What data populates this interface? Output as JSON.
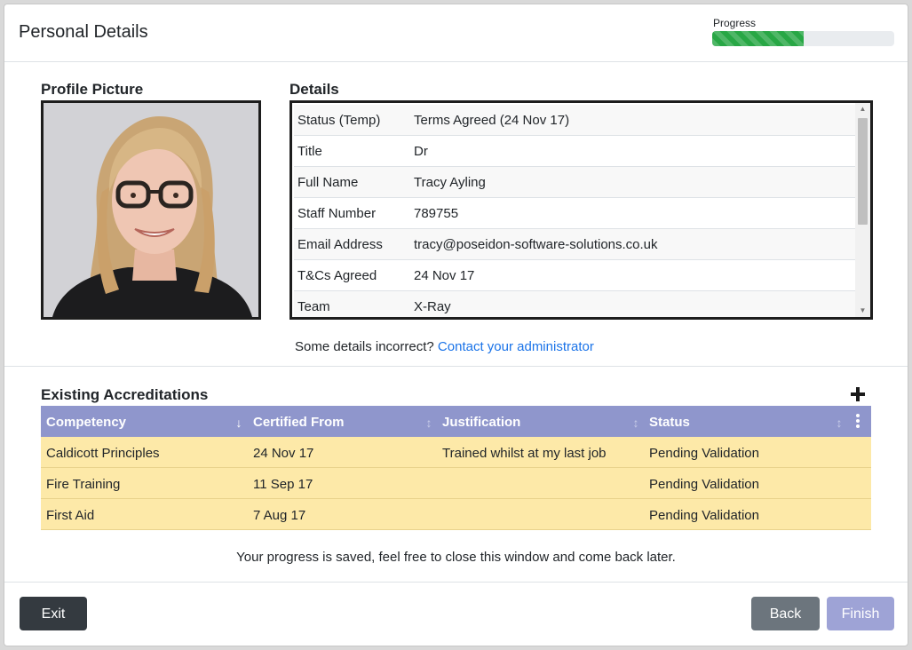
{
  "header": {
    "title": "Personal Details",
    "progress_label": "Progress",
    "progress_fraction": 0.5
  },
  "profile": {
    "heading": "Profile Picture"
  },
  "details": {
    "heading": "Details",
    "rows": [
      {
        "label": "Status (Temp)",
        "value": "Terms Agreed (24 Nov 17)"
      },
      {
        "label": "Title",
        "value": "Dr"
      },
      {
        "label": "Full Name",
        "value": "Tracy Ayling"
      },
      {
        "label": "Staff Number",
        "value": "789755"
      },
      {
        "label": "Email Address",
        "value": "tracy@poseidon-software-solutions.co.uk"
      },
      {
        "label": "T&Cs Agreed",
        "value": "24 Nov 17"
      },
      {
        "label": "Team",
        "value": "X-Ray"
      }
    ],
    "help_text": "Some details incorrect?",
    "help_link": "Contact your administrator"
  },
  "accreditations": {
    "heading": "Existing Accreditations",
    "add_icon": "plus-icon",
    "columns": [
      "Competency",
      "Certified From",
      "Justification",
      "Status"
    ],
    "rows": [
      {
        "competency": "Caldicott Principles",
        "certified_from": "24 Nov 17",
        "justification": "Trained whilst at my last job",
        "status": "Pending Validation"
      },
      {
        "competency": "Fire Training",
        "certified_from": "11 Sep 17",
        "justification": "",
        "status": "Pending Validation"
      },
      {
        "competency": "First Aid",
        "certified_from": "7 Aug 17",
        "justification": "",
        "status": "Pending Validation"
      }
    ]
  },
  "footer": {
    "saved_note": "Your progress is saved, feel free to close this window and come back later.",
    "exit_label": "Exit",
    "back_label": "Back",
    "finish_label": "Finish"
  },
  "colors": {
    "progress": "#28a745",
    "table_header": "#8f96cc",
    "row_pending": "#fde9a8",
    "link": "#1a73e8",
    "exit_button": "#343a40",
    "back_button": "#6c757d",
    "finish_button": "#9ea3d6"
  }
}
